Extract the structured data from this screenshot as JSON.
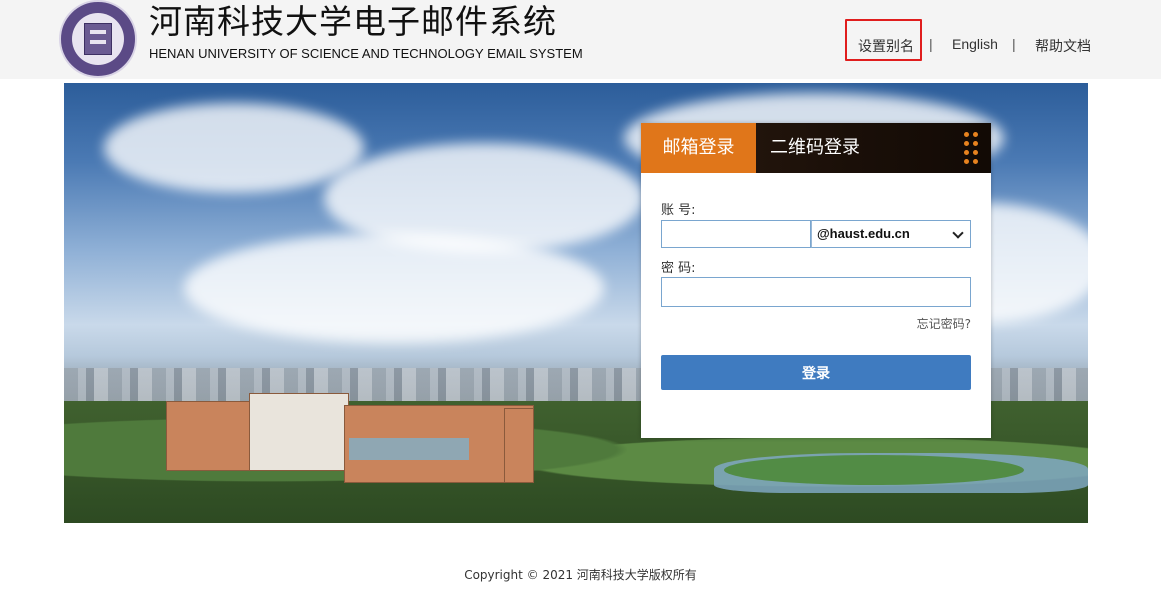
{
  "header": {
    "title_cn": "河南科技大学电子邮件系统",
    "title_en": "HENAN UNIVERSITY OF SCIENCE AND TECHNOLOGY EMAIL SYSTEM",
    "logo_icon": "university-seal-icon"
  },
  "nav": {
    "alias": "设置别名",
    "separator": "|",
    "english": "English",
    "help": "帮助文档"
  },
  "login": {
    "tab_email": "邮箱登录",
    "tab_qr": "二维码登录",
    "qr_icon": "grid-dots-icon",
    "account_label": "账 号:",
    "account_value": "",
    "domain_selected": "@haust.edu.cn",
    "password_label": "密 码:",
    "password_value": "",
    "forgot": "忘记密码?",
    "submit": "登录"
  },
  "footer": {
    "copyright": "Copyright © 2021 河南科技大学版权所有"
  },
  "colors": {
    "accent_orange": "#e0761a",
    "button_blue": "#3f7bc0",
    "highlight_red": "#e01d1d"
  }
}
